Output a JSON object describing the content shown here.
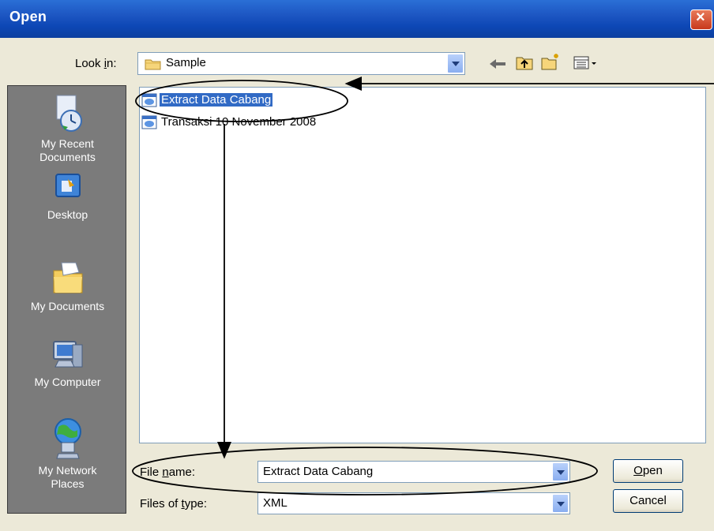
{
  "dialog": {
    "title": "Open"
  },
  "look_in": {
    "label_before": "Look ",
    "label_key": "i",
    "label_after": "n:",
    "value": "Sample"
  },
  "places": [
    {
      "label": "My Recent\nDocuments",
      "icon": "recent-documents-icon"
    },
    {
      "label": "Desktop",
      "icon": "desktop-icon"
    },
    {
      "label": "My Documents",
      "icon": "my-documents-icon"
    },
    {
      "label": "My Computer",
      "icon": "my-computer-icon"
    },
    {
      "label": "My Network\nPlaces",
      "icon": "network-places-icon"
    }
  ],
  "files": [
    {
      "name": "Extract Data Cabang",
      "selected": true
    },
    {
      "name": "Transaksi 10 November 2008",
      "selected": false
    }
  ],
  "file_name": {
    "label_before": "File ",
    "label_key": "n",
    "label_after": "ame:",
    "value": "Extract Data Cabang"
  },
  "file_type": {
    "label_before": "Files of ",
    "label_key": "t",
    "label_after": "ype:",
    "value": "XML"
  },
  "buttons": {
    "open_key": "O",
    "open_rest": "pen",
    "cancel": "Cancel"
  },
  "toolbar": {
    "icons": [
      "back-arrow-icon",
      "up-folder-icon",
      "new-folder-icon",
      "views-menu-icon"
    ]
  },
  "colors": {
    "titlebar": "#0c3f9f",
    "selection": "#316ac5",
    "places_bar": "#7b7b7b"
  }
}
